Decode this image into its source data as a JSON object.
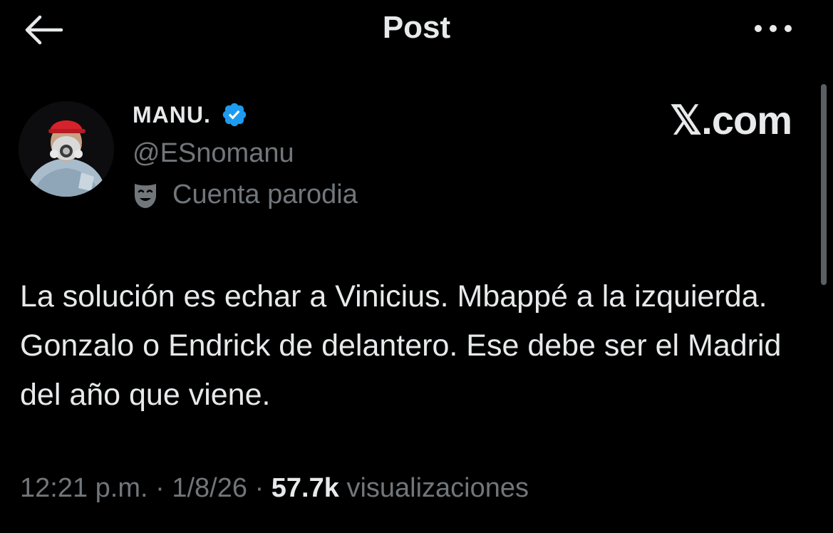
{
  "header": {
    "title": "Post",
    "back_icon": "arrow-left-icon",
    "more_icon": "more-horizontal-icon"
  },
  "author": {
    "name": "MANU.",
    "handle": "@ESnomanu",
    "verified": true,
    "label": "Cuenta parodia",
    "label_icon": "theater-mask-icon"
  },
  "brand": "𝕏.com",
  "tweet": {
    "text": "La solución es echar a Vinicius. Mbappé a la izquierda. Gonzalo o Endrick de delantero. Ese debe ser el Madrid del año que viene."
  },
  "meta": {
    "time": "12:21 p.m.",
    "separator": "·",
    "date": "1/8/26",
    "views_count": "57.7k",
    "views_label": "visualizaciones"
  },
  "colors": {
    "background": "#000000",
    "text_primary": "#e7e9ea",
    "text_secondary": "#71767b",
    "verified_blue": "#1d9bf0"
  }
}
